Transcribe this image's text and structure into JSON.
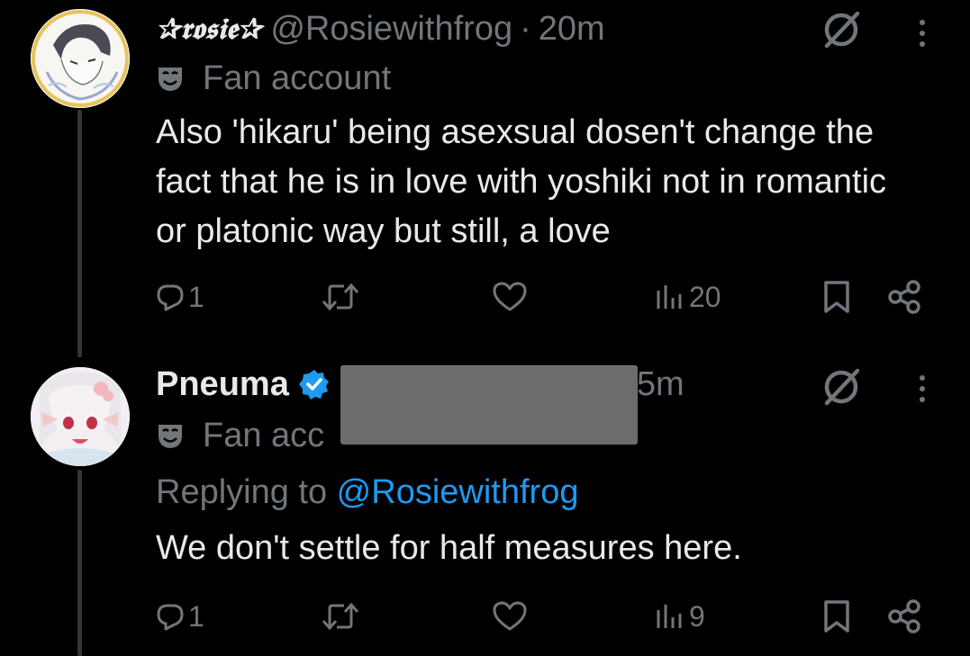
{
  "tweets": [
    {
      "display_name": "✰𝖗𝖔𝖘𝖎𝖊✰",
      "handle": "@Rosiewithfrog",
      "separator": "·",
      "time": "20m",
      "badge": "Fan account",
      "text": "Also 'hikaru' being asexsual dosen't change the fact that he is in love with yoshiki not in romantic or platonic way but still, a love",
      "reply_count": "1",
      "view_count": "20"
    },
    {
      "display_name": "Pneuma",
      "time_partial": "5m",
      "badge": "Fan acc",
      "replying_prefix": "Replying to ",
      "replying_handle": "@Rosiewithfrog",
      "text": "We don't settle for half measures here.",
      "reply_count": "1",
      "view_count": "9"
    }
  ],
  "colors": {
    "background": "#000000",
    "primary_text": "#e7e9ea",
    "secondary_text": "#71767b",
    "accent_blue": "#1d9bf0",
    "verified": "#1d9bf0",
    "redaction": "#6c6c6c"
  },
  "icons": [
    "grok-icon",
    "more-icon",
    "fan-mask-icon",
    "verified-icon",
    "reply-icon",
    "retweet-icon",
    "like-icon",
    "views-icon",
    "bookmark-icon",
    "share-icon"
  ]
}
